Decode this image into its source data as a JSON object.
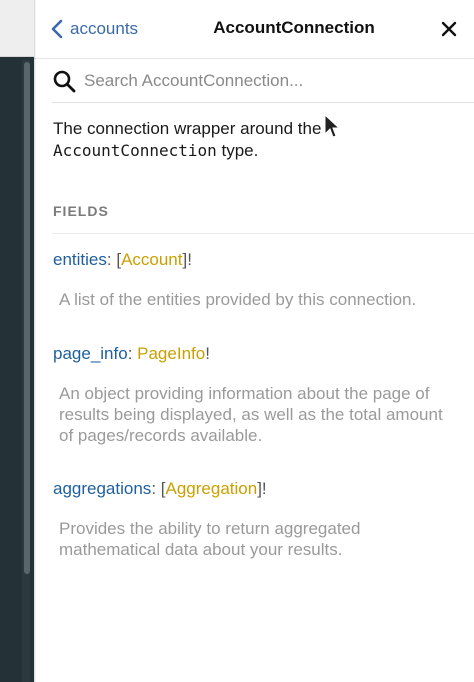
{
  "header": {
    "back_label": "accounts",
    "title": "AccountConnection"
  },
  "search": {
    "placeholder": "Search AccountConnection..."
  },
  "description": {
    "prefix": "The connection wrapper around the",
    "code": "AccountConnection",
    "suffix": " type."
  },
  "section_label": "FIELDS",
  "fields": [
    {
      "name": "entities",
      "open": "[",
      "type": "Account",
      "close": "]!",
      "description": "A list of the entities provided by this connection."
    },
    {
      "name": "page_info",
      "open": "",
      "type": "PageInfo",
      "close": "!",
      "description": "An object providing information about the page of results being displayed, as well as the total amount of pages/records available."
    },
    {
      "name": "aggregations",
      "open": "[",
      "type": "Aggregation",
      "close": "]!",
      "description": "Provides the ability to return aggregated mathematical data about your results."
    }
  ],
  "colors": {
    "field_name": "#1f5f9e",
    "type_name": "#caa000",
    "description_text": "#9a9a9a",
    "editor_background": "#243238"
  },
  "icons": {
    "back": "chevron-left-icon",
    "close": "close-icon",
    "search": "search-icon"
  }
}
